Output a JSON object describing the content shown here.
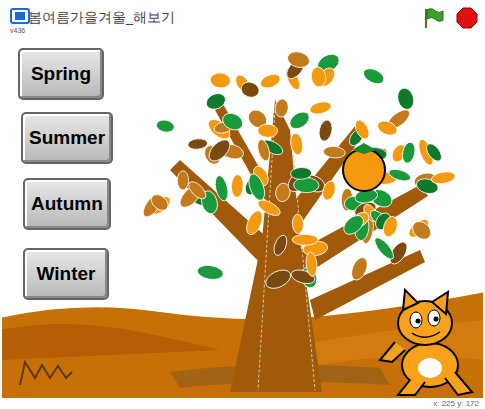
{
  "window": {
    "title": "봄여름가을겨울_해보기",
    "version": "v436"
  },
  "buttons": [
    {
      "label": "Spring"
    },
    {
      "label": "Summer"
    },
    {
      "label": "Autumn"
    },
    {
      "label": "Winter"
    }
  ],
  "mouse_readout": "x: 225 y: 172"
}
